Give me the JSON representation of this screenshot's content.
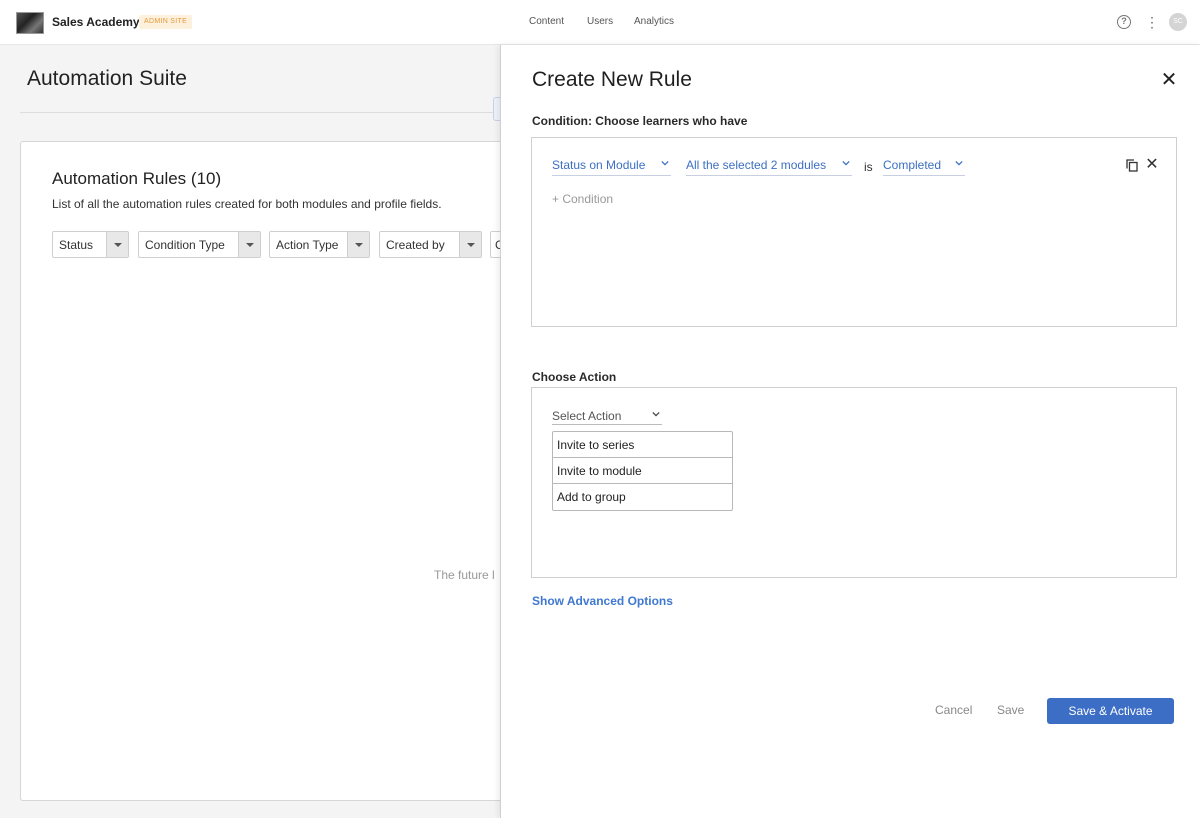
{
  "topbar": {
    "brand": "Sales Academy",
    "badge": "ADMIN SITE",
    "nav": [
      "Content",
      "Users",
      "Analytics"
    ],
    "help_symbol": "?",
    "menu_symbol": "⋮",
    "avatar_initials": "SC"
  },
  "page": {
    "title": "Automation Suite",
    "card_title": "Automation Rules (10)",
    "card_subtitle": "List of all the automation rules created for both modules and profile fields.",
    "filters": [
      "Status",
      "Condition Type",
      "Action Type",
      "Created by",
      "C"
    ],
    "empty_text": "The future l"
  },
  "drawer": {
    "title": "Create New Rule",
    "close_symbol": "✕",
    "condition_label": "Condition: Choose learners who have",
    "condition": {
      "field": "Status on Module",
      "modules": "All the selected 2 modules",
      "operator": "is",
      "value": "Completed",
      "remove_symbol": "✕"
    },
    "add_condition": "+ Condition",
    "action_label": "Choose Action",
    "select_action_placeholder": "Select Action",
    "action_options": [
      "Invite to series",
      "Invite to module",
      "Add to group"
    ],
    "advanced_link": "Show Advanced Options",
    "buttons": {
      "cancel": "Cancel",
      "save": "Save",
      "save_activate": "Save & Activate"
    }
  },
  "colors": {
    "accent": "#3d6ec6",
    "link": "#3c6fc4",
    "badge_bg": "#fdf0dc",
    "badge_text": "#e39a3b"
  }
}
